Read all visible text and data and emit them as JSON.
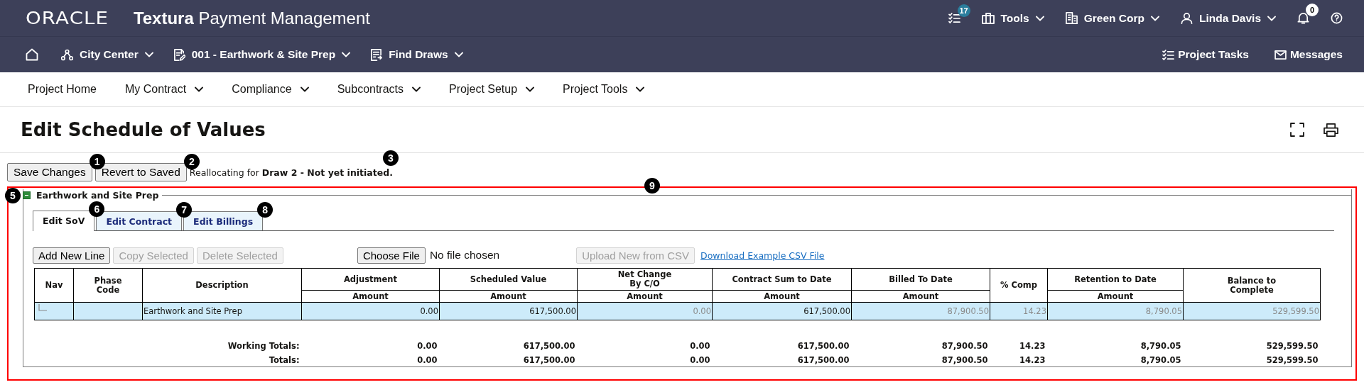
{
  "header": {
    "logo": "ORACLE",
    "app_title": "**Textura** Payment Management",
    "tasks_badge": "17",
    "menus": [
      {
        "kind": "tools",
        "label": "Tools"
      },
      {
        "kind": "company",
        "label": "Green Corp"
      },
      {
        "kind": "user",
        "label": "Linda Davis"
      }
    ],
    "notifications_badge": "0"
  },
  "project_bar": {
    "items": [
      {
        "kind": "project",
        "label": "City Center"
      },
      {
        "kind": "contract",
        "label": "001 - Earthwork & Site Prep"
      },
      {
        "kind": "draws",
        "label": "Find Draws"
      }
    ],
    "links": [
      {
        "kind": "tasks",
        "label": "Project Tasks"
      },
      {
        "kind": "messages",
        "label": "Messages"
      }
    ]
  },
  "nav": [
    {
      "label": "Project Home",
      "dropdown": false
    },
    {
      "label": "My Contract",
      "dropdown": true
    },
    {
      "label": "Compliance",
      "dropdown": true
    },
    {
      "label": "Subcontracts",
      "dropdown": true
    },
    {
      "label": "Project Setup",
      "dropdown": true
    },
    {
      "label": "Project Tools",
      "dropdown": true
    }
  ],
  "page_title": "Edit Schedule of Values",
  "actions": [
    {
      "label": "Save Changes",
      "callout": "1"
    },
    {
      "label": "Revert to Saved",
      "callout": "2"
    }
  ],
  "status": {
    "text": "Reallocating for **Draw 2 - Not yet initiated.**",
    "callout": "3"
  },
  "section": {
    "title": "Earthwork and Site Prep",
    "expanded": true,
    "callout": "5",
    "highlighted": true,
    "highlight_callout": "9",
    "tabs": [
      {
        "label": "Edit SoV",
        "selected": true,
        "callout": "6"
      },
      {
        "label": "Edit Contract",
        "selected": false,
        "callout": "7"
      },
      {
        "label": "Edit Billings",
        "selected": false,
        "callout": "8"
      }
    ],
    "toolbar": {
      "buttons": [
        {
          "label": "Add New Line",
          "disabled": false
        },
        {
          "label": "Copy Selected",
          "disabled": true
        },
        {
          "label": "Delete Selected",
          "disabled": true
        }
      ],
      "file_button": "Choose File",
      "file_status": "No file chosen",
      "upload": {
        "label": "Upload New from CSV",
        "disabled": true
      },
      "link": "Download Example CSV File"
    },
    "table": {
      "columns": [
        {
          "label": "Nav"
        },
        {
          "label": "Phase\nCode"
        },
        {
          "label": "Description"
        },
        {
          "label": "Adjustment",
          "sub": "Amount"
        },
        {
          "label": "Scheduled Value",
          "sub": "Amount"
        },
        {
          "label": "Net Change\nBy C/O",
          "sub": "Amount"
        },
        {
          "label": "Contract Sum to Date",
          "sub": "Amount"
        },
        {
          "label": "Billed To Date",
          "sub": "Amount"
        },
        {
          "label": "% Comp"
        },
        {
          "label": "Retention to Date",
          "sub": "Amount"
        },
        {
          "label": "Balance to\nComplete"
        }
      ],
      "rows": [
        {
          "selected": true,
          "description": "Earthwork and Site Prep",
          "values": [
            {
              "text": "0.00",
              "disabled": false
            },
            {
              "text": "617,500.00",
              "disabled": false
            },
            {
              "text": "0.00",
              "disabled": true
            },
            {
              "text": "617,500.00",
              "disabled": false
            },
            {
              "text": "87,900.50",
              "disabled": true
            },
            {
              "text": "14.23",
              "disabled": true
            },
            {
              "text": "8,790.05",
              "disabled": true
            },
            {
              "text": "529,599.50",
              "disabled": true
            }
          ]
        }
      ],
      "totals": [
        {
          "label": "Working Totals:",
          "values": [
            "0.00",
            "617,500.00",
            "0.00",
            "617,500.00",
            "87,900.50",
            "14.23",
            "8,790.05",
            "529,599.50"
          ]
        },
        {
          "label": "Totals:",
          "values": [
            "0.00",
            "617,500.00",
            "0.00",
            "617,500.00",
            "87,900.50",
            "14.23",
            "8,790.05",
            "529,599.50"
          ]
        }
      ]
    }
  }
}
